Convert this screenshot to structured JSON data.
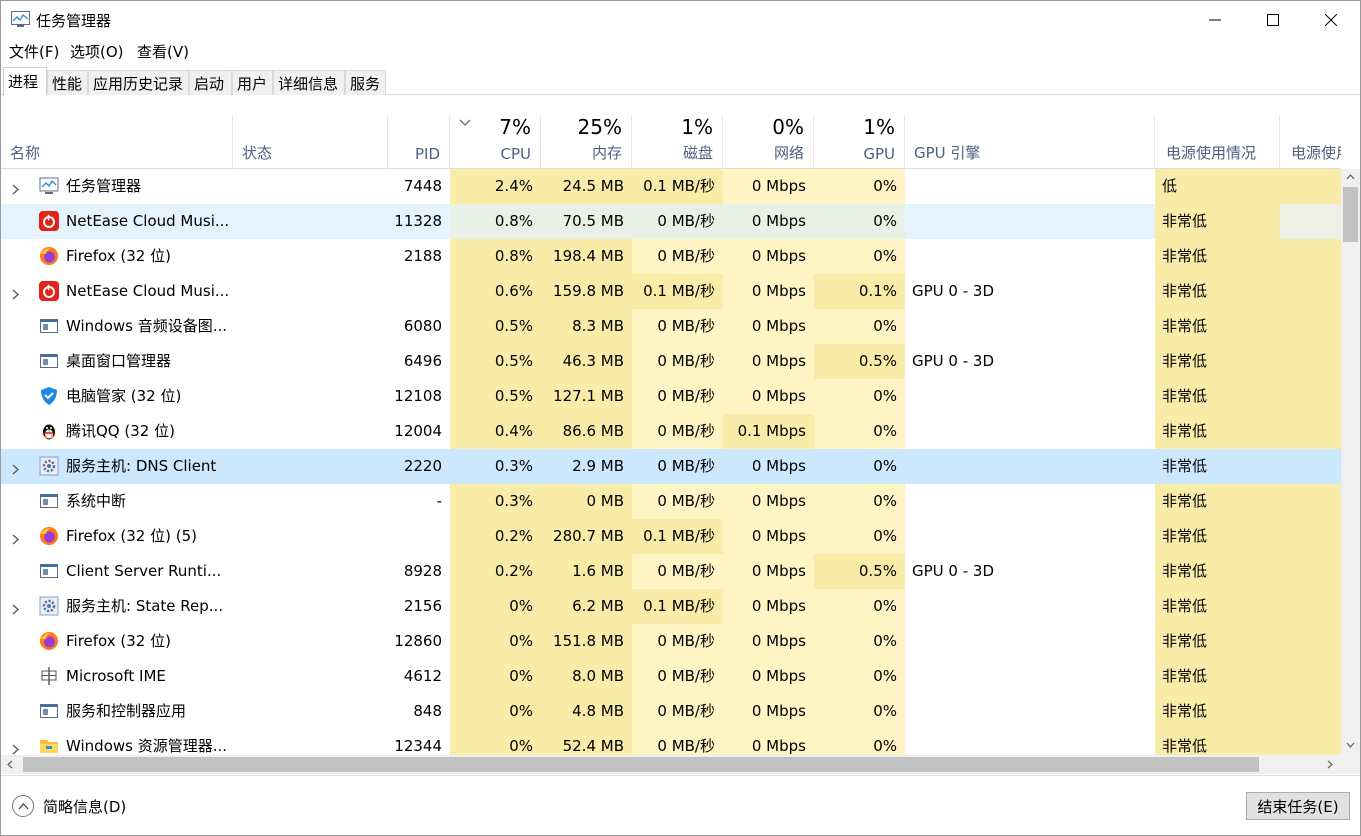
{
  "window": {
    "title": "任务管理器"
  },
  "menu": [
    "文件(F)",
    "选项(O)",
    "查看(V)"
  ],
  "tabs": [
    "进程",
    "性能",
    "应用历史记录",
    "启动",
    "用户",
    "详细信息",
    "服务"
  ],
  "header": {
    "name": "名称",
    "status": "状态",
    "pid": "PID",
    "cpu_pct": "7%",
    "cpu": "CPU",
    "mem_pct": "25%",
    "mem": "内存",
    "disk_pct": "1%",
    "disk": "磁盘",
    "net_pct": "0%",
    "net": "网络",
    "gpu_pct": "1%",
    "gpu": "GPU",
    "gpu_engine": "GPU 引擎",
    "power": "电源使用情况",
    "power_trend": "电源使用情"
  },
  "rows": [
    {
      "name": "任务管理器",
      "pid": "7448",
      "cpu": "2.4%",
      "mem": "24.5 MB",
      "disk": "0.1 MB/秒",
      "net": "0 Mbps",
      "gpu": "0%",
      "engine": "",
      "power": "低",
      "icon": "taskmgr-icon",
      "expand": true
    },
    {
      "name": "NetEase Cloud Musi...",
      "pid": "11328",
      "cpu": "0.8%",
      "mem": "70.5 MB",
      "disk": "0 MB/秒",
      "net": "0 Mbps",
      "gpu": "0%",
      "engine": "",
      "power": "非常低",
      "icon": "netease-icon",
      "expand": false
    },
    {
      "name": "Firefox (32 位)",
      "pid": "2188",
      "cpu": "0.8%",
      "mem": "198.4 MB",
      "disk": "0 MB/秒",
      "net": "0 Mbps",
      "gpu": "0%",
      "engine": "",
      "power": "非常低",
      "icon": "firefox-icon",
      "expand": false
    },
    {
      "name": "NetEase Cloud Musi...",
      "pid": "",
      "cpu": "0.6%",
      "mem": "159.8 MB",
      "disk": "0.1 MB/秒",
      "net": "0 Mbps",
      "gpu": "0.1%",
      "engine": "GPU 0 - 3D",
      "power": "非常低",
      "icon": "netease-icon",
      "expand": true
    },
    {
      "name": "Windows 音频设备图...",
      "pid": "6080",
      "cpu": "0.5%",
      "mem": "8.3 MB",
      "disk": "0 MB/秒",
      "net": "0 Mbps",
      "gpu": "0%",
      "engine": "",
      "power": "非常低",
      "icon": "window-icon",
      "expand": false
    },
    {
      "name": "桌面窗口管理器",
      "pid": "6496",
      "cpu": "0.5%",
      "mem": "46.3 MB",
      "disk": "0 MB/秒",
      "net": "0 Mbps",
      "gpu": "0.5%",
      "engine": "GPU 0 - 3D",
      "power": "非常低",
      "icon": "window-icon",
      "expand": false
    },
    {
      "name": "电脑管家 (32 位)",
      "pid": "12108",
      "cpu": "0.5%",
      "mem": "127.1 MB",
      "disk": "0 MB/秒",
      "net": "0 Mbps",
      "gpu": "0%",
      "engine": "",
      "power": "非常低",
      "icon": "shield-icon",
      "expand": false
    },
    {
      "name": "腾讯QQ (32 位)",
      "pid": "12004",
      "cpu": "0.4%",
      "mem": "86.6 MB",
      "disk": "0 MB/秒",
      "net": "0.1 Mbps",
      "gpu": "0%",
      "engine": "",
      "power": "非常低",
      "icon": "qq-penguin-icon",
      "expand": false
    },
    {
      "name": "服务主机: DNS Client",
      "pid": "2220",
      "cpu": "0.3%",
      "mem": "2.9 MB",
      "disk": "0 MB/秒",
      "net": "0 Mbps",
      "gpu": "0%",
      "engine": "",
      "power": "非常低",
      "icon": "gear-icon",
      "expand": true
    },
    {
      "name": "系统中断",
      "pid": "-",
      "cpu": "0.3%",
      "mem": "0 MB",
      "disk": "0 MB/秒",
      "net": "0 Mbps",
      "gpu": "0%",
      "engine": "",
      "power": "非常低",
      "icon": "window-icon",
      "expand": false
    },
    {
      "name": "Firefox (32 位) (5)",
      "pid": "",
      "cpu": "0.2%",
      "mem": "280.7 MB",
      "disk": "0.1 MB/秒",
      "net": "0 Mbps",
      "gpu": "0%",
      "engine": "",
      "power": "非常低",
      "icon": "firefox-icon",
      "expand": true
    },
    {
      "name": "Client Server Runti...",
      "pid": "8928",
      "cpu": "0.2%",
      "mem": "1.6 MB",
      "disk": "0 MB/秒",
      "net": "0 Mbps",
      "gpu": "0.5%",
      "engine": "GPU 0 - 3D",
      "power": "非常低",
      "icon": "window-icon",
      "expand": false
    },
    {
      "name": "服务主机: State Rep...",
      "pid": "2156",
      "cpu": "0%",
      "mem": "6.2 MB",
      "disk": "0.1 MB/秒",
      "net": "0 Mbps",
      "gpu": "0%",
      "engine": "",
      "power": "非常低",
      "icon": "gear-icon",
      "expand": true
    },
    {
      "name": "Firefox (32 位)",
      "pid": "12860",
      "cpu": "0%",
      "mem": "151.8 MB",
      "disk": "0 MB/秒",
      "net": "0 Mbps",
      "gpu": "0%",
      "engine": "",
      "power": "非常低",
      "icon": "firefox-icon",
      "expand": false
    },
    {
      "name": "Microsoft IME",
      "pid": "4612",
      "cpu": "0%",
      "mem": "8.0 MB",
      "disk": "0 MB/秒",
      "net": "0 Mbps",
      "gpu": "0%",
      "engine": "",
      "power": "非常低",
      "icon": "ime-icon",
      "expand": false
    },
    {
      "name": "服务和控制器应用",
      "pid": "848",
      "cpu": "0%",
      "mem": "4.8 MB",
      "disk": "0 MB/秒",
      "net": "0 Mbps",
      "gpu": "0%",
      "engine": "",
      "power": "非常低",
      "icon": "window-icon",
      "expand": false
    },
    {
      "name": "Windows 资源管理器...",
      "pid": "12344",
      "cpu": "0%",
      "mem": "52.4 MB",
      "disk": "0 MB/秒",
      "net": "0 Mbps",
      "gpu": "0%",
      "engine": "",
      "power": "非常低",
      "icon": "folder-icon",
      "expand": true
    }
  ],
  "footer": {
    "fewer_details": "简略信息(D)",
    "end_task": "结束任务(E)"
  },
  "colors": {
    "heat_light": "#fff4c4",
    "heat_mid": "#f9eca8",
    "selected": "#cce8ff",
    "hover": "#e5f3ff",
    "header_label": "#4d6082"
  }
}
